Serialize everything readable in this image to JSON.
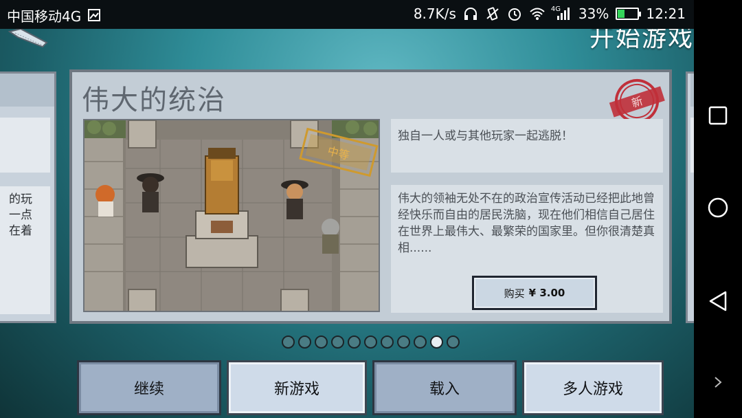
{
  "status_bar": {
    "carrier": "中国移动4G",
    "speed": "8.7K/s",
    "network": "4G",
    "battery_percent": "33%",
    "battery_level": 0.33,
    "time": "12:21",
    "icons": [
      "image-icon",
      "headset-icon",
      "vibrate-icon",
      "alarm-icon",
      "wifi-icon",
      "signal-icon",
      "battery-icon"
    ]
  },
  "header": {
    "title": "开始游戏"
  },
  "card": {
    "title": "伟大的统治",
    "stamp_new": "新",
    "stamp_difficulty": "中等",
    "desc_short": "独自一人或与其他玩家一起逃脱！",
    "desc_long": "伟大的领袖无处不在的政治宣传活动已经把此地曾经快乐而自由的居民洗脑，现在他们相信自己居住在世界上最伟大、最繁荣的国家里。但你很清楚真相......",
    "buy_label": "购买",
    "buy_price": "¥ 3.00"
  },
  "left_card": {
    "text": "的玩\n一点\n在着"
  },
  "pager": {
    "total": 11,
    "active_index": 9
  },
  "menu": {
    "continue": "继续",
    "new_game": "新游戏",
    "load": "载入",
    "multiplayer": "多人游戏"
  },
  "colors": {
    "accent_bg": "#2f8d98",
    "card_bg": "#c3cdd6",
    "stamp_red": "#c0303a"
  }
}
